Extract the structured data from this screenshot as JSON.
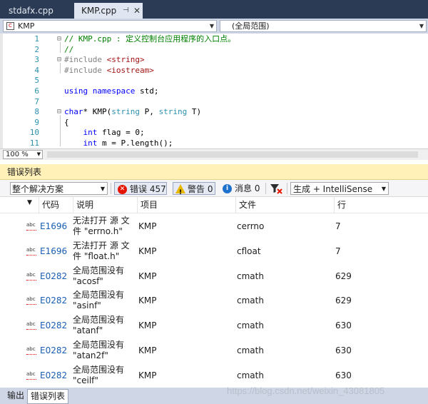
{
  "tabs": [
    {
      "label": "stdafx.cpp",
      "active": false
    },
    {
      "label": "KMP.cpp",
      "active": true
    }
  ],
  "tab_pin_icon": "⊣",
  "tab_close_icon": "✕",
  "nav": {
    "project": "KMP",
    "scope": "(全局范围)"
  },
  "code_lines": [
    {
      "num": "1",
      "fold": "⊟",
      "tokens": [
        {
          "t": "// KMP.cpp : 定义控制台应用程序的入口点。",
          "c": "c-com"
        }
      ]
    },
    {
      "num": "2",
      "fold": "",
      "tokens": [
        {
          "t": "//",
          "c": "c-com"
        }
      ]
    },
    {
      "num": "3",
      "fold": "⊟",
      "tokens": [
        {
          "t": "#include ",
          "c": "c-pre"
        },
        {
          "t": "<string>",
          "c": "c-str"
        }
      ]
    },
    {
      "num": "4",
      "fold": "",
      "tokens": [
        {
          "t": "#include ",
          "c": "c-pre"
        },
        {
          "t": "<iostream>",
          "c": "c-str"
        }
      ]
    },
    {
      "num": "5",
      "fold": "",
      "tokens": []
    },
    {
      "num": "6",
      "fold": "",
      "tokens": [
        {
          "t": "using",
          "c": "c-kw"
        },
        {
          "t": " ",
          "c": "c-plain"
        },
        {
          "t": "namespace",
          "c": "c-kw"
        },
        {
          "t": " std;",
          "c": "c-plain"
        }
      ]
    },
    {
      "num": "7",
      "fold": "",
      "tokens": []
    },
    {
      "num": "8",
      "fold": "⊟",
      "tokens": [
        {
          "t": "char",
          "c": "c-kw"
        },
        {
          "t": "* KMP(",
          "c": "c-plain"
        },
        {
          "t": "string",
          "c": "c-type"
        },
        {
          "t": " P, ",
          "c": "c-plain"
        },
        {
          "t": "string",
          "c": "c-type"
        },
        {
          "t": " T)",
          "c": "c-plain"
        }
      ]
    },
    {
      "num": "9",
      "fold": "",
      "tokens": [
        {
          "t": "{",
          "c": "c-plain"
        }
      ]
    },
    {
      "num": "10",
      "fold": "",
      "tokens": [
        {
          "t": "    ",
          "c": "c-plain"
        },
        {
          "t": "int",
          "c": "c-kw"
        },
        {
          "t": " flag = 0;",
          "c": "c-plain"
        }
      ]
    },
    {
      "num": "11",
      "fold": "",
      "tokens": [
        {
          "t": "    ",
          "c": "c-plain"
        },
        {
          "t": "int",
          "c": "c-kw"
        },
        {
          "t": " m = P.length();",
          "c": "c-plain"
        }
      ]
    }
  ],
  "zoom": "100 %",
  "error_list": {
    "title": "错误列表",
    "scope": "整个解决方案",
    "errors_label": "错误 457",
    "warnings_label": "警告 0",
    "messages_label": "消息 0",
    "build_filter": "生成 + IntelliSense",
    "columns": {
      "code": "代码",
      "desc": "说明",
      "project": "项目",
      "file": "文件",
      "line": "行"
    },
    "rows": [
      {
        "code": "E1696",
        "desc": "无法打开 源 文件 \"errno.h\"",
        "project": "KMP",
        "file": "cerrno",
        "line": "7"
      },
      {
        "code": "E1696",
        "desc": "无法打开 源 文件 \"float.h\"",
        "project": "KMP",
        "file": "cfloat",
        "line": "7"
      },
      {
        "code": "E0282",
        "desc": "全局范围没有 \"acosf\"",
        "project": "KMP",
        "file": "cmath",
        "line": "629"
      },
      {
        "code": "E0282",
        "desc": "全局范围没有 \"asinf\"",
        "project": "KMP",
        "file": "cmath",
        "line": "629"
      },
      {
        "code": "E0282",
        "desc": "全局范围没有 \"atanf\"",
        "project": "KMP",
        "file": "cmath",
        "line": "630"
      },
      {
        "code": "E0282",
        "desc": "全局范围没有 \"atan2f\"",
        "project": "KMP",
        "file": "cmath",
        "line": "630"
      },
      {
        "code": "E0282",
        "desc": "全局范围没有 \"ceilf\"",
        "project": "KMP",
        "file": "cmath",
        "line": "630"
      }
    ]
  },
  "bottom_tabs": [
    {
      "label": "输出",
      "active": false
    },
    {
      "label": "错误列表",
      "active": true
    }
  ],
  "watermark": "https://blog.csdn.net/weixin_43081805"
}
